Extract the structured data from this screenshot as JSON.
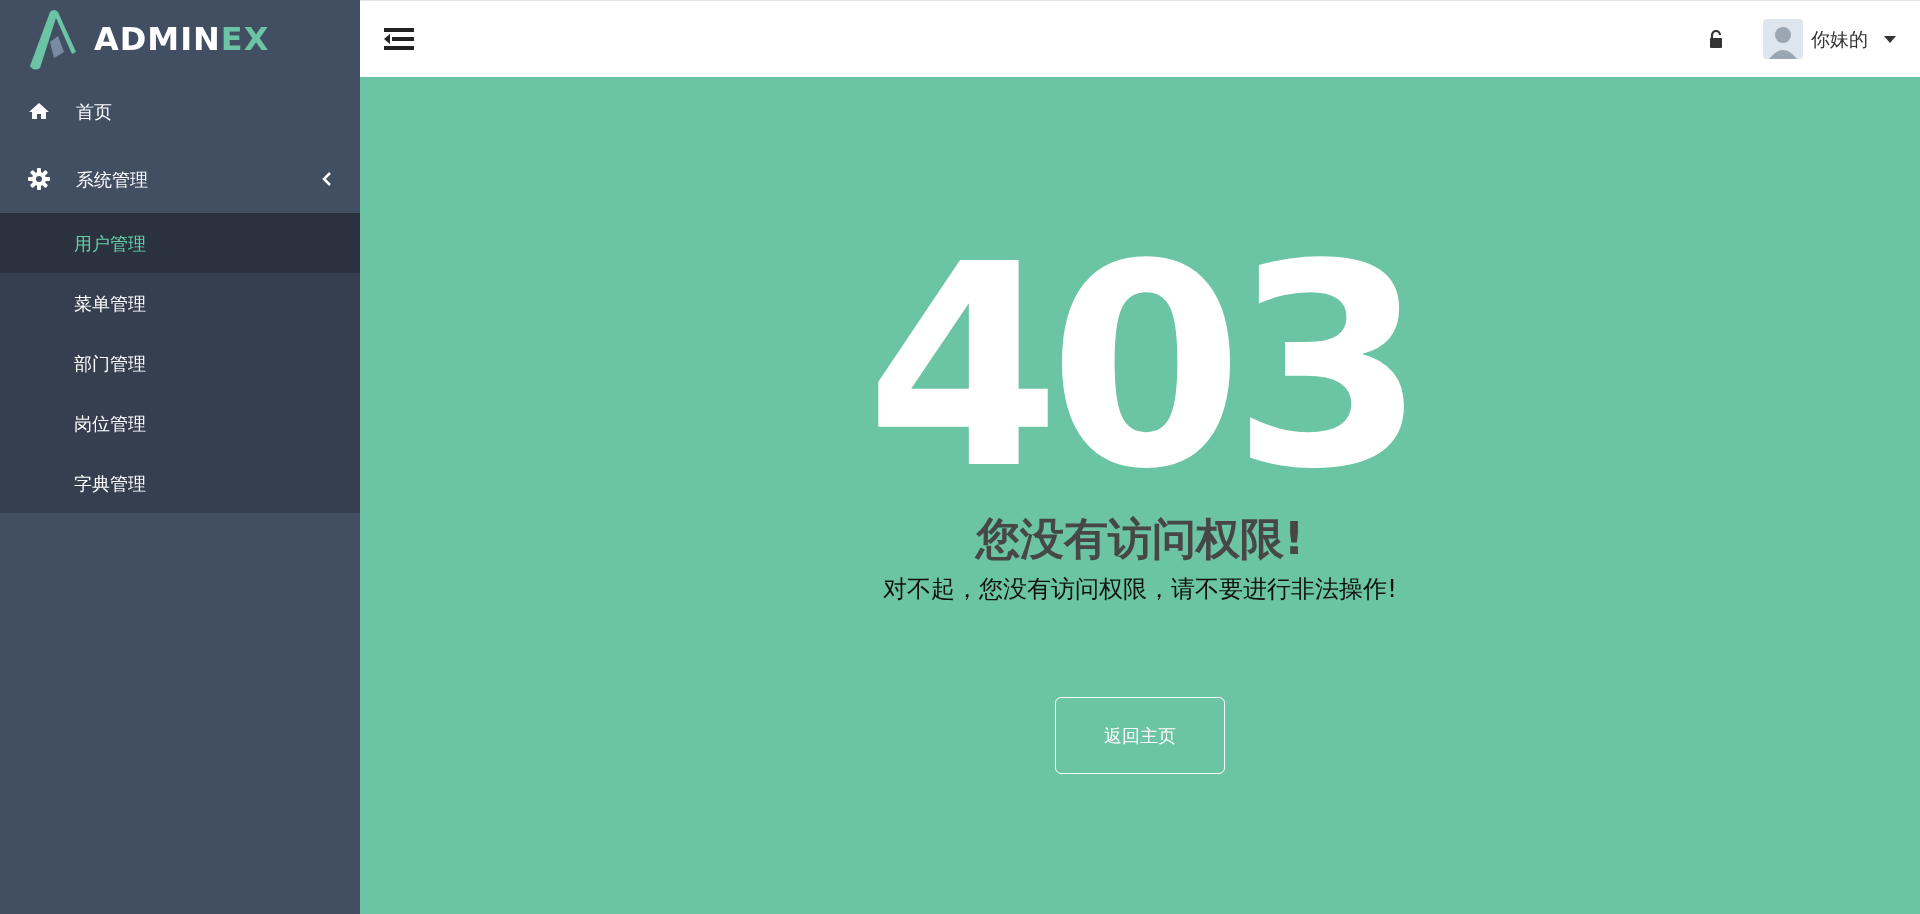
{
  "logo": {
    "parts": [
      {
        "text": "ADMIN",
        "color": "#ffffff"
      },
      {
        "text": "EX",
        "color": "#6bc4a4"
      }
    ]
  },
  "sidebar": {
    "items": [
      {
        "label": "首页",
        "kind": "home"
      },
      {
        "label": "系统管理",
        "kind": "settings",
        "expanded": true,
        "children": [
          {
            "label": "用户管理",
            "selected": true
          },
          {
            "label": "菜单管理",
            "selected": false
          },
          {
            "label": "部门管理",
            "selected": false
          },
          {
            "label": "岗位管理",
            "selected": false
          },
          {
            "label": "字典管理",
            "selected": false
          }
        ]
      }
    ]
  },
  "header": {
    "user": {
      "name": "你妹的"
    }
  },
  "error": {
    "code": "403",
    "title": "您没有访问权限!",
    "message": "对不起，您没有访问权限，请不要进行非法操作!",
    "button": "返回主页"
  }
}
